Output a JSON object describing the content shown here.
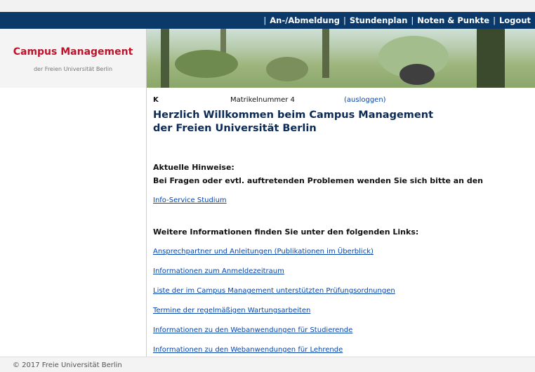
{
  "nav": {
    "items": [
      "An-/Abmeldung",
      "Stundenplan",
      "Noten & Punkte",
      "Logout"
    ]
  },
  "brand": {
    "title": "Campus Management",
    "subtitle": "der Freien Universität Berlin"
  },
  "user": {
    "initial": "K",
    "matrikel": "Matrikelnummer 4",
    "logout_link": "(ausloggen)"
  },
  "welcome": {
    "line1": "Herzlich Willkommen beim Campus Management",
    "line2": "der Freien Universität Berlin"
  },
  "notices": {
    "title": "Aktuelle Hinweise:",
    "text": "Bei Fragen oder evtl. auftretenden Problemen wenden Sie sich bitte an den",
    "link": "Info-Service Studium"
  },
  "more": {
    "title": "Weitere Informationen finden Sie unter den folgenden Links:",
    "links": [
      "Ansprechpartner und Anleitungen (Publikationen im Überblick)",
      "Informationen zum Anmeldezeitraum",
      "Liste der im Campus Management unterstützten Prüfungsordnungen",
      "Termine der regelmäßigen Wartungsarbeiten",
      "Informationen zu den Webanwendungen für Studierende",
      "Informationen zu den Webanwendungen für Lehrende"
    ]
  },
  "footer": {
    "text": "© 2017 Freie Universität Berlin"
  },
  "colors": {
    "navbar": "#0b3a6a",
    "brand": "#c0122b",
    "link": "#0645ad"
  }
}
